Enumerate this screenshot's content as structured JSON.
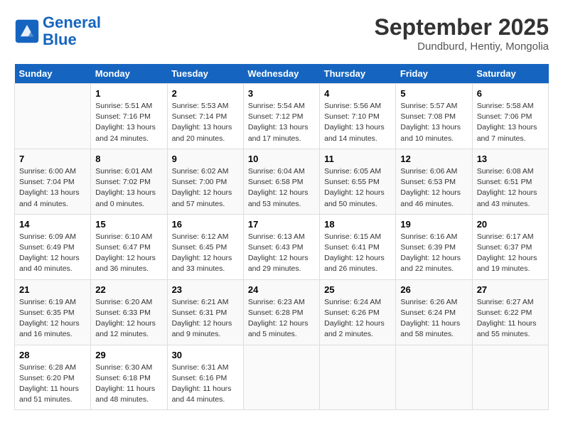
{
  "logo": {
    "line1": "General",
    "line2": "Blue"
  },
  "title": "September 2025",
  "location": "Dundburd, Hentiy, Mongolia",
  "weekdays": [
    "Sunday",
    "Monday",
    "Tuesday",
    "Wednesday",
    "Thursday",
    "Friday",
    "Saturday"
  ],
  "weeks": [
    [
      {
        "day": null
      },
      {
        "day": "1",
        "sunrise": "5:51 AM",
        "sunset": "7:16 PM",
        "daylight": "13 hours and 24 minutes."
      },
      {
        "day": "2",
        "sunrise": "5:53 AM",
        "sunset": "7:14 PM",
        "daylight": "13 hours and 20 minutes."
      },
      {
        "day": "3",
        "sunrise": "5:54 AM",
        "sunset": "7:12 PM",
        "daylight": "13 hours and 17 minutes."
      },
      {
        "day": "4",
        "sunrise": "5:56 AM",
        "sunset": "7:10 PM",
        "daylight": "13 hours and 14 minutes."
      },
      {
        "day": "5",
        "sunrise": "5:57 AM",
        "sunset": "7:08 PM",
        "daylight": "13 hours and 10 minutes."
      },
      {
        "day": "6",
        "sunrise": "5:58 AM",
        "sunset": "7:06 PM",
        "daylight": "13 hours and 7 minutes."
      }
    ],
    [
      {
        "day": "7",
        "sunrise": "6:00 AM",
        "sunset": "7:04 PM",
        "daylight": "13 hours and 4 minutes."
      },
      {
        "day": "8",
        "sunrise": "6:01 AM",
        "sunset": "7:02 PM",
        "daylight": "13 hours and 0 minutes."
      },
      {
        "day": "9",
        "sunrise": "6:02 AM",
        "sunset": "7:00 PM",
        "daylight": "12 hours and 57 minutes."
      },
      {
        "day": "10",
        "sunrise": "6:04 AM",
        "sunset": "6:58 PM",
        "daylight": "12 hours and 53 minutes."
      },
      {
        "day": "11",
        "sunrise": "6:05 AM",
        "sunset": "6:55 PM",
        "daylight": "12 hours and 50 minutes."
      },
      {
        "day": "12",
        "sunrise": "6:06 AM",
        "sunset": "6:53 PM",
        "daylight": "12 hours and 46 minutes."
      },
      {
        "day": "13",
        "sunrise": "6:08 AM",
        "sunset": "6:51 PM",
        "daylight": "12 hours and 43 minutes."
      }
    ],
    [
      {
        "day": "14",
        "sunrise": "6:09 AM",
        "sunset": "6:49 PM",
        "daylight": "12 hours and 40 minutes."
      },
      {
        "day": "15",
        "sunrise": "6:10 AM",
        "sunset": "6:47 PM",
        "daylight": "12 hours and 36 minutes."
      },
      {
        "day": "16",
        "sunrise": "6:12 AM",
        "sunset": "6:45 PM",
        "daylight": "12 hours and 33 minutes."
      },
      {
        "day": "17",
        "sunrise": "6:13 AM",
        "sunset": "6:43 PM",
        "daylight": "12 hours and 29 minutes."
      },
      {
        "day": "18",
        "sunrise": "6:15 AM",
        "sunset": "6:41 PM",
        "daylight": "12 hours and 26 minutes."
      },
      {
        "day": "19",
        "sunrise": "6:16 AM",
        "sunset": "6:39 PM",
        "daylight": "12 hours and 22 minutes."
      },
      {
        "day": "20",
        "sunrise": "6:17 AM",
        "sunset": "6:37 PM",
        "daylight": "12 hours and 19 minutes."
      }
    ],
    [
      {
        "day": "21",
        "sunrise": "6:19 AM",
        "sunset": "6:35 PM",
        "daylight": "12 hours and 16 minutes."
      },
      {
        "day": "22",
        "sunrise": "6:20 AM",
        "sunset": "6:33 PM",
        "daylight": "12 hours and 12 minutes."
      },
      {
        "day": "23",
        "sunrise": "6:21 AM",
        "sunset": "6:31 PM",
        "daylight": "12 hours and 9 minutes."
      },
      {
        "day": "24",
        "sunrise": "6:23 AM",
        "sunset": "6:28 PM",
        "daylight": "12 hours and 5 minutes."
      },
      {
        "day": "25",
        "sunrise": "6:24 AM",
        "sunset": "6:26 PM",
        "daylight": "12 hours and 2 minutes."
      },
      {
        "day": "26",
        "sunrise": "6:26 AM",
        "sunset": "6:24 PM",
        "daylight": "11 hours and 58 minutes."
      },
      {
        "day": "27",
        "sunrise": "6:27 AM",
        "sunset": "6:22 PM",
        "daylight": "11 hours and 55 minutes."
      }
    ],
    [
      {
        "day": "28",
        "sunrise": "6:28 AM",
        "sunset": "6:20 PM",
        "daylight": "11 hours and 51 minutes."
      },
      {
        "day": "29",
        "sunrise": "6:30 AM",
        "sunset": "6:18 PM",
        "daylight": "11 hours and 48 minutes."
      },
      {
        "day": "30",
        "sunrise": "6:31 AM",
        "sunset": "6:16 PM",
        "daylight": "11 hours and 44 minutes."
      },
      {
        "day": null
      },
      {
        "day": null
      },
      {
        "day": null
      },
      {
        "day": null
      }
    ]
  ]
}
